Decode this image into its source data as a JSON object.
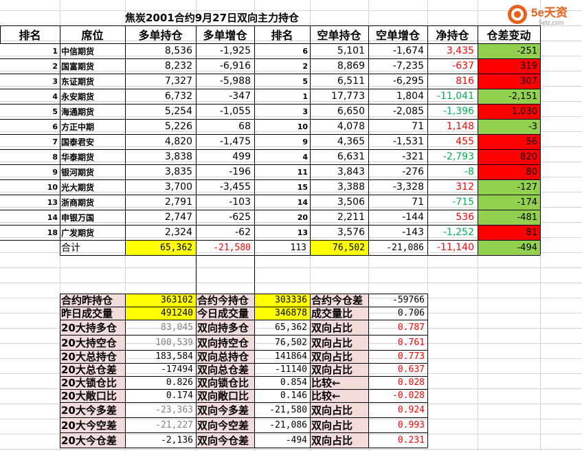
{
  "title": "焦炭2001合约9月27日双向主力持仓",
  "logo": {
    "text": "5e天资",
    "sub": "5etz.com"
  },
  "colors": {
    "green": "#92d050",
    "red": "#ff0000",
    "yellow": "#ffff00",
    "pink": "#f2dcdb"
  },
  "headers": [
    "排名",
    "席位",
    "多单持仓",
    "多单增仓",
    "排名",
    "空单持仓",
    "空单增仓",
    "净持仓",
    "仓差变动"
  ],
  "rows": [
    {
      "rank": "1",
      "name": "中信期货",
      "long": "8,536",
      "long_chg": "-1,925",
      "srank": "6",
      "short": "5,101",
      "short_chg": "-1,674",
      "net": "3,435",
      "net_color": "red",
      "diff": "-251",
      "diff_color": "green"
    },
    {
      "rank": "2",
      "name": "国富期货",
      "long": "8,232",
      "long_chg": "-6,916",
      "srank": "2",
      "short": "8,869",
      "short_chg": "-7,235",
      "net": "-637",
      "net_color": "red",
      "diff": "319",
      "diff_color": "red"
    },
    {
      "rank": "3",
      "name": "东证期货",
      "long": "7,327",
      "long_chg": "-5,988",
      "srank": "5",
      "short": "6,511",
      "short_chg": "-6,295",
      "net": "816",
      "net_color": "red",
      "diff": "307",
      "diff_color": "red"
    },
    {
      "rank": "4",
      "name": "永安期货",
      "long": "6,732",
      "long_chg": "-347",
      "srank": "1",
      "short": "17,773",
      "short_chg": "1,804",
      "net": "-11,041",
      "net_color": "green",
      "diff": "-2,151",
      "diff_color": "green"
    },
    {
      "rank": "5",
      "name": "海通期货",
      "long": "5,254",
      "long_chg": "-1,055",
      "srank": "3",
      "short": "6,650",
      "short_chg": "-2,085",
      "net": "-1,396",
      "net_color": "green",
      "diff": "1,030",
      "diff_color": "red"
    },
    {
      "rank": "6",
      "name": "方正中期",
      "long": "5,226",
      "long_chg": "68",
      "srank": "10",
      "short": "4,078",
      "short_chg": "71",
      "net": "1,148",
      "net_color": "red",
      "diff": "-3",
      "diff_color": "green"
    },
    {
      "rank": "7",
      "name": "国泰君安",
      "long": "4,820",
      "long_chg": "-1,475",
      "srank": "9",
      "short": "4,365",
      "short_chg": "-1,531",
      "net": "455",
      "net_color": "red",
      "diff": "56",
      "diff_color": "red"
    },
    {
      "rank": "8",
      "name": "华泰期货",
      "long": "3,838",
      "long_chg": "499",
      "srank": "4",
      "short": "6,631",
      "short_chg": "-321",
      "net": "-2,793",
      "net_color": "green",
      "diff": "820",
      "diff_color": "red"
    },
    {
      "rank": "9",
      "name": "银河期货",
      "long": "3,835",
      "long_chg": "-196",
      "srank": "11",
      "short": "3,843",
      "short_chg": "-276",
      "net": "-8",
      "net_color": "green",
      "diff": "80",
      "diff_color": "red"
    },
    {
      "rank": "10",
      "name": "光大期货",
      "long": "3,700",
      "long_chg": "-3,455",
      "srank": "15",
      "short": "3,388",
      "short_chg": "-3,328",
      "net": "312",
      "net_color": "red",
      "diff": "-127",
      "diff_color": "green"
    },
    {
      "rank": "13",
      "name": "浙商期货",
      "long": "2,791",
      "long_chg": "-103",
      "srank": "14",
      "short": "3,506",
      "short_chg": "71",
      "net": "-715",
      "net_color": "green",
      "diff": "-174",
      "diff_color": "green"
    },
    {
      "rank": "14",
      "name": "申银万国",
      "long": "2,747",
      "long_chg": "-625",
      "srank": "20",
      "short": "2,211",
      "short_chg": "-144",
      "net": "536",
      "net_color": "red",
      "diff": "-481",
      "diff_color": "green"
    },
    {
      "rank": "18",
      "name": "广发期货",
      "long": "2,324",
      "long_chg": "-62",
      "srank": "13",
      "short": "3,576",
      "short_chg": "-143",
      "net": "-1,252",
      "net_color": "green",
      "diff": "81",
      "diff_color": "red"
    }
  ],
  "total": {
    "label": "合计",
    "long": "65,362",
    "long_chg": "-21,580",
    "srank": "113",
    "short": "76,502",
    "short_chg": "-21,086",
    "net": "-11,140",
    "diff": "-494"
  },
  "stats": [
    [
      "合约昨持仓",
      "363102",
      "合约今持仓",
      "303336",
      "合约今仓差",
      "-59766"
    ],
    [
      "昨日成交量",
      "491240",
      "今日成交量",
      "346878",
      "成交量比",
      "0.706"
    ],
    [
      "20大持多仓",
      "83,045",
      "双向持多仓",
      "65,362",
      "双向占比",
      "0.787"
    ],
    [
      "20大持空仓",
      "100,539",
      "双向持空仓",
      "76,502",
      "双向占比",
      "0.761"
    ],
    [
      "20大总持仓",
      "183,584",
      "双向总持仓",
      "141864",
      "双向占比",
      "0.773"
    ],
    [
      "20大总仓差",
      "-17494",
      "双向总仓差",
      "-11140",
      "双向占比",
      "0.637"
    ],
    [
      "20大锁仓比",
      "0.826",
      "双向锁仓比",
      "0.854",
      "比较←",
      "0.028"
    ],
    [
      "20大敞口比",
      "0.174",
      "双向敞口比",
      "0.146",
      "比较←",
      "-0.028"
    ],
    [
      "20大今多差",
      "-23,363",
      "双向今多差",
      "-21,580",
      "双向占比",
      "0.924"
    ],
    [
      "20大今空差",
      "-21,227",
      "双向今空差",
      "-21,086",
      "双向占比",
      "0.993"
    ],
    [
      "20大今仓差",
      "-2,136",
      "双向今仓差",
      "-494",
      "双向占比",
      "0.231"
    ]
  ]
}
